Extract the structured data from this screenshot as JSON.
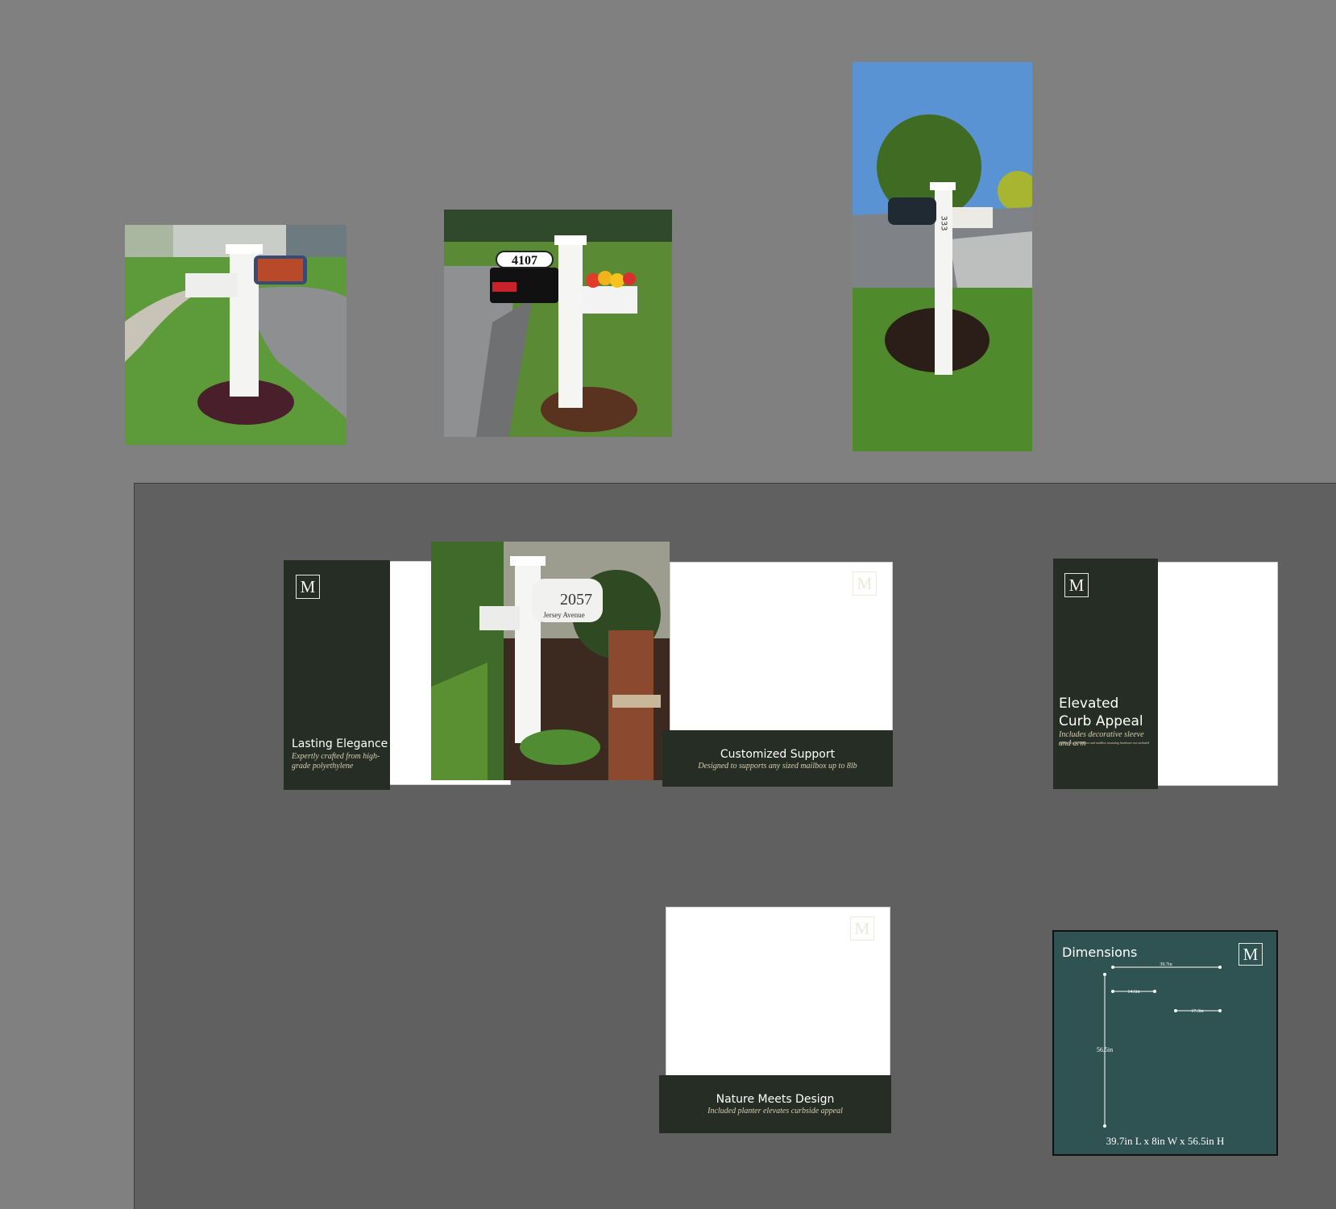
{
  "photos": [
    {
      "name": "mailbox-photo-1",
      "alt": "white mailbox post with floral mailbox"
    },
    {
      "name": "mailbox-photo-2",
      "number_plate": "4107"
    },
    {
      "name": "mailbox-photo-3",
      "post_numbers": "333"
    }
  ],
  "slides": {
    "lasting": {
      "logo": "M",
      "title": "Lasting Elegance",
      "subtitle": "Expertly crafted from high-grade polyethylene"
    },
    "center_photo": {
      "address_number": "2057",
      "address_street": "Jersey Avenue"
    },
    "customized": {
      "logo": "M",
      "title": "Customized Support",
      "subtitle": "Designed to supports any sized mailbox up to 8lb"
    },
    "elevated": {
      "logo": "M",
      "title_line1": "Elevated",
      "title_line2": "Curb Appeal",
      "subtitle": "Includes decorative sleeve and arm",
      "fineprint": "4x4 wood post, mailbox and mailbox mounting hardware not included"
    },
    "nature": {
      "logo": "M",
      "title": "Nature Meets Design",
      "subtitle": "Included planter elevates curbside appeal"
    },
    "dimensions": {
      "logo": "M",
      "title": "Dimensions",
      "top_width": "39.7in",
      "arm_width": "14.6in",
      "planter_width": "17.3in",
      "height": "56.5in",
      "summary": "39.7in L x 8in W x 56.5in H"
    }
  },
  "colors": {
    "canvas": "#808080",
    "artboard": "#606060",
    "dark_green": "#262d24",
    "teal": "#2f5353",
    "cream": "#d6cfb3"
  }
}
